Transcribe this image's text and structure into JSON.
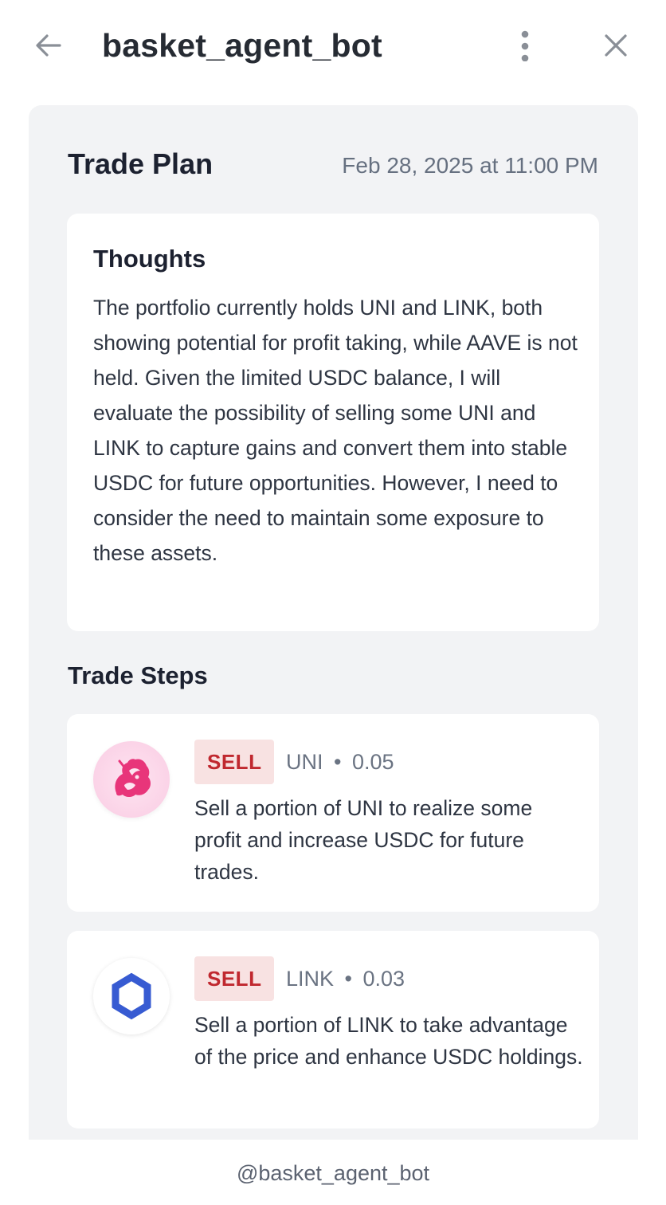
{
  "header": {
    "title": "basket_agent_bot",
    "back_icon": "arrow-left-icon",
    "more_icon": "more-vertical-icon",
    "close_icon": "close-icon"
  },
  "trade_plan": {
    "title": "Trade Plan",
    "date": "Feb 28, 2025 at 11:00 PM",
    "thoughts": {
      "heading": "Thoughts",
      "text": "The portfolio currently holds UNI and LINK, both showing potential for profit taking, while AAVE is not held. Given the limited USDC balance, I will evaluate the possibility of selling some UNI and LINK to capture gains and convert them into stable USDC for future opportunities. However, I need to consider the need to maintain some exposure to these assets."
    },
    "steps_heading": "Trade Steps",
    "steps": [
      {
        "action": "SELL",
        "token": "UNI",
        "separator": "•",
        "amount": "0.05",
        "description": "Sell a portion of UNI to realize some profit and increase USDC for future trades.",
        "icon": "uniswap-unicorn-icon"
      },
      {
        "action": "SELL",
        "token": "LINK",
        "separator": "•",
        "amount": "0.03",
        "description": "Sell a portion of LINK to take advantage of the price and enhance USDC holdings.",
        "icon": "chainlink-hexagon-icon"
      }
    ]
  },
  "footer": {
    "handle": "@basket_agent_bot"
  },
  "colors": {
    "panel_bg": "#f2f3f5",
    "sell_badge_bg": "#f8e2e2",
    "sell_badge_text": "#c0282f",
    "uni_pink": "#e8357a",
    "link_blue": "#375bd2"
  }
}
